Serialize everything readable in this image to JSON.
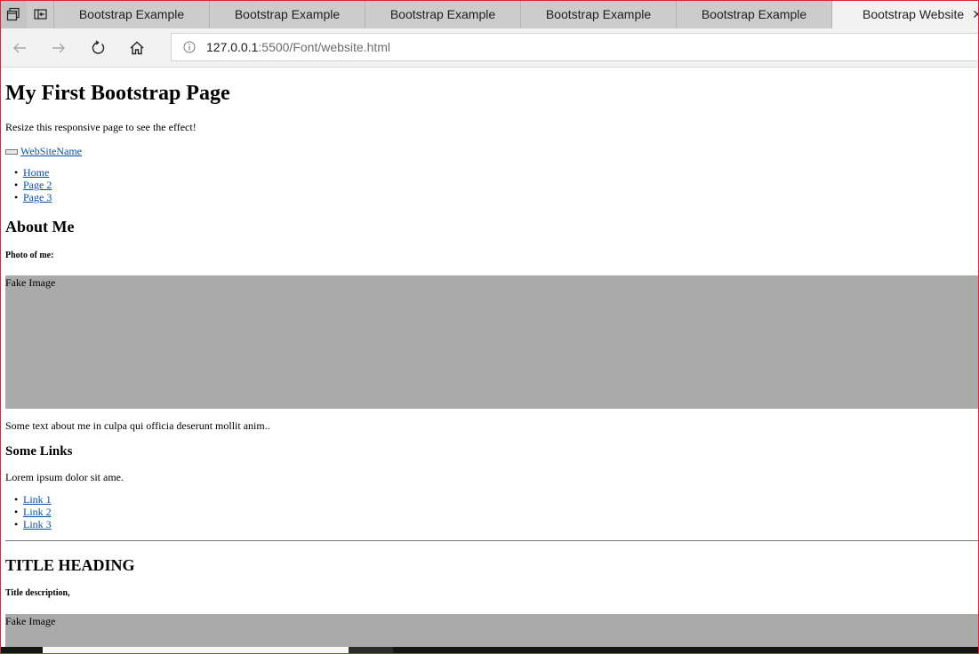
{
  "tabs": [
    {
      "label": "Bootstrap Example"
    },
    {
      "label": "Bootstrap Example"
    },
    {
      "label": "Bootstrap Example"
    },
    {
      "label": "Bootstrap Example"
    },
    {
      "label": "Bootstrap Example"
    },
    {
      "label": "Bootstrap Website"
    }
  ],
  "toolbar": {
    "url_host": "127.0.0.1",
    "url_rest": ":5500/Font/website.html"
  },
  "page": {
    "title": "My First Bootstrap Page",
    "subtitle": "Resize this responsive page to see the effect!",
    "brand": "WebSiteName",
    "nav": [
      "Home",
      "Page 2",
      "Page 3"
    ],
    "about_heading": "About Me",
    "photo_label": "Photo of me:",
    "fake_image": "Fake Image",
    "about_text": "Some text about me in culpa qui officia deserunt mollit anim..",
    "links_heading": "Some Links",
    "links_text": "Lorem ipsum dolor sit ame.",
    "links": [
      "Link 1",
      "Link 2",
      "Link 3"
    ],
    "section_heading": "TITLE HEADING",
    "section_desc": "Title description,",
    "fake_image_2": "Fake Image"
  },
  "colors": {
    "link": "#0b4ea2",
    "placeholder": "#aaaaaa",
    "window_border": "#e0262e"
  }
}
